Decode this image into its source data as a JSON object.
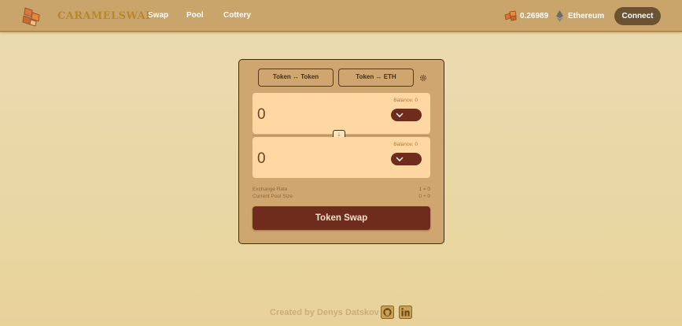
{
  "header": {
    "brand": "CARAMELSWAP",
    "nav": [
      {
        "label": "Swap"
      },
      {
        "label": "Pool"
      },
      {
        "label": "Cottery"
      }
    ],
    "balance": "0.26989",
    "network": "Ethereum",
    "connect_label": "Connect"
  },
  "swap": {
    "tabs": [
      {
        "label": "Token ↔ Token"
      },
      {
        "label": "Token ↔ ETH"
      }
    ],
    "from": {
      "value": "0",
      "balance": "Balance: 0"
    },
    "to": {
      "value": "0",
      "balance": "Balance: 0"
    },
    "info": {
      "rate_label": "Exchange Rate",
      "rate_value": "1 = 0",
      "pool_label": "Current Pool Size",
      "pool_value": "0 + 0"
    },
    "button_label": "Token Swap"
  },
  "footer": {
    "credit": "Created by Denys Datskov"
  },
  "colors": {
    "accent": "#6f2b1c",
    "header_bg": "#c9a56b",
    "panel_bg": "#ffd7a3",
    "card_bg": "#cfa670"
  },
  "icons": [
    "caramel-logo-icon",
    "caramel-coin-icon",
    "ethereum-icon",
    "gear-icon",
    "chevron-down-icon",
    "swap-arrows-icon",
    "github-icon",
    "linkedin-icon"
  ]
}
